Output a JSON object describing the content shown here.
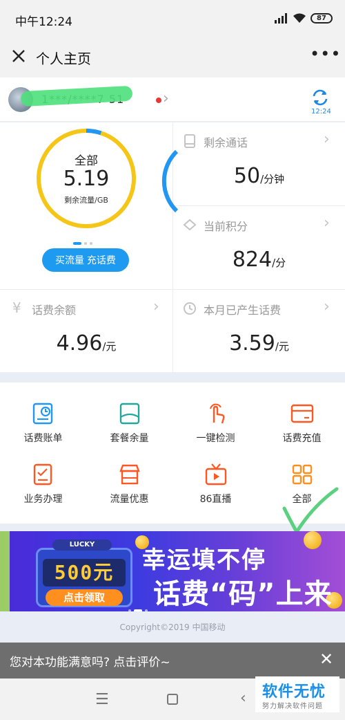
{
  "status_bar": {
    "time": "中午12:24",
    "battery": "87"
  },
  "nav": {
    "title": "个人主页",
    "close_icon": "close-icon",
    "more_label": "•••"
  },
  "account": {
    "phone_masked": "1***/****7 51",
    "refresh_time": "12:24",
    "arrow": "›"
  },
  "data_ring": {
    "label": "全部",
    "value": "5.19",
    "sub_label": "剩余流量/GB",
    "remaining_fraction": 0.95,
    "ring_color": "#f5c518",
    "used_color": "#2196f3",
    "button_label": "买流量 充话费"
  },
  "cards": {
    "calls": {
      "label": "剩余通话",
      "value": "50",
      "unit": "/分钟",
      "icon": "phone-icon"
    },
    "points": {
      "label": "当前积分",
      "value": "824",
      "unit": "/分",
      "icon": "diamond-icon"
    },
    "balance": {
      "label": "话费余额",
      "value": "4.96",
      "unit": "/元",
      "icon": "yen-icon"
    },
    "monthly": {
      "label": "本月已产生话费",
      "value": "3.59",
      "unit": "/元",
      "icon": "clock-icon"
    }
  },
  "shortcuts": [
    {
      "label": "话费账单",
      "icon": "bill-icon",
      "color": "#2196f3"
    },
    {
      "label": "套餐余量",
      "icon": "package-icon",
      "color": "#26a69a"
    },
    {
      "label": "一键检测",
      "icon": "touch-icon",
      "color": "#ff5722"
    },
    {
      "label": "话费充值",
      "icon": "card-icon",
      "color": "#ff5722"
    },
    {
      "label": "业务办理",
      "icon": "form-icon",
      "color": "#ff5722"
    },
    {
      "label": "流量优惠",
      "icon": "shop-icon",
      "color": "#ff5722"
    },
    {
      "label": "86直播",
      "icon": "tv-icon",
      "color": "#ff5722"
    },
    {
      "label": "全部",
      "icon": "grid-icon",
      "color": "#ff8f1f"
    }
  ],
  "banner": {
    "badge": "LUCKY",
    "amount": "500元",
    "claim_label": "点击领取",
    "slogan_line1": "幸运填不停",
    "slogan_line2": "话费“码”上来"
  },
  "footer": {
    "copyright": "Copyright©2019 中国移动"
  },
  "feedback": {
    "text": "您对本功能满意吗? 点击评价~",
    "close": "✕"
  },
  "system_nav": {
    "menu": "☰",
    "back": "‹"
  },
  "watermark": {
    "title": "软件无忧",
    "subtitle": "努力解决软件问题"
  }
}
